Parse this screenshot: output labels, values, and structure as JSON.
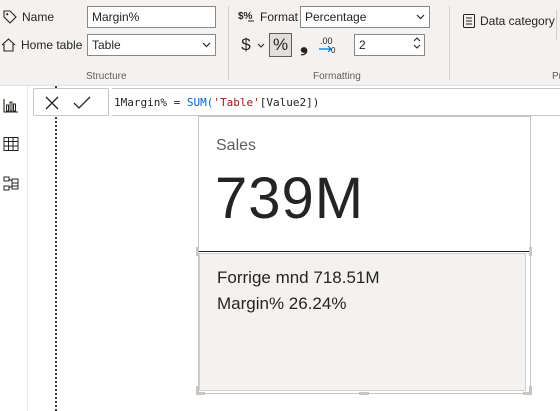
{
  "ribbon": {
    "structure": {
      "name_label": "Name",
      "name_value": "Margin%",
      "home_table_label": "Home table",
      "home_table_value": "Table",
      "group_label": "Structure"
    },
    "formatting": {
      "format_label": "Format",
      "format_value": "Percentage",
      "currency_symbol": "$",
      "percent_symbol": "%",
      "comma_symbol": "❟",
      "decimal_symbol": ".00",
      "decimals_value": "2",
      "group_label": "Formatting"
    },
    "properties": {
      "data_category_label": "Data category",
      "group_label_partial": "Pr"
    }
  },
  "formula_bar": {
    "line_number": "1",
    "measure_name": "Margin% = ",
    "function_name": "SUM(",
    "argument": "'Table'",
    "column": "[Value2])"
  },
  "card": {
    "title": "Sales",
    "value": "739M",
    "line1": "Forrige mnd 718.51M",
    "line2": "Margin% 26.24%"
  },
  "colors": {
    "ribbon_bg": "#f3f2f1",
    "keyword_blue": "#0066cc",
    "string_red": "#a31515"
  }
}
